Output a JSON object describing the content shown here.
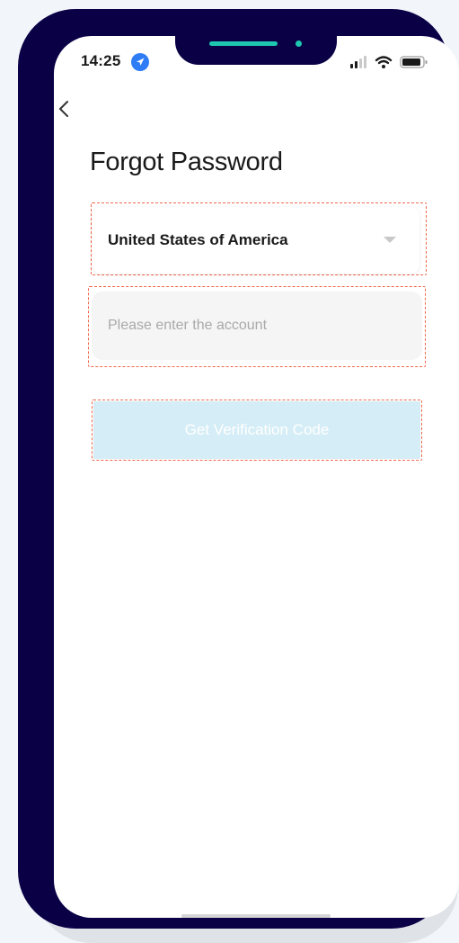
{
  "status_bar": {
    "time": "14:25",
    "location_icon": "location-arrow-icon",
    "signal_icon": "cellular-signal-icon",
    "wifi_icon": "wifi-icon",
    "battery_icon": "battery-icon"
  },
  "nav": {
    "back_icon": "chevron-left-icon"
  },
  "page": {
    "title": "Forgot Password"
  },
  "form": {
    "country_value": "United States of America",
    "account_placeholder": "Please enter the account",
    "account_value": "",
    "verify_button_label": "Get Verification Code"
  },
  "colors": {
    "device_frame": "#0a0046",
    "accent": "#1ec8b0",
    "highlight_dash": "#f0684e",
    "button_disabled_bg": "#d5edf6",
    "location_blue": "#2f7df6"
  }
}
